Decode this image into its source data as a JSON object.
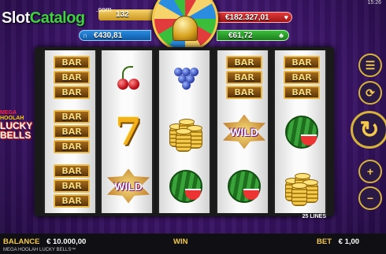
{
  "clock": "15:26",
  "watermark": {
    "part1": "Slot",
    "part2": "Catalog",
    "suffix": ".com"
  },
  "jackpots": {
    "top_left": "132",
    "bottom_left": "€430,81",
    "top_right": "€182.327,01",
    "bottom_right": "€61,72",
    "bottom_right_icon": "clover-icon",
    "top_right_icon": "heart-icon",
    "bottom_left_icon": "horseshoe-icon"
  },
  "logo": {
    "line1": "MEGA",
    "line2": "HOOLAH",
    "line3": "LUCKY",
    "line4": "BELLS"
  },
  "reels": [
    [
      "bar3",
      "bar3",
      "bar3"
    ],
    [
      "cherries",
      "seven",
      "wild"
    ],
    [
      "grapes",
      "coins",
      "watermelon"
    ],
    [
      "bar3",
      "wild",
      "watermelon"
    ],
    [
      "bar3",
      "watermelon",
      "coins"
    ]
  ],
  "symbols": {
    "bar": "BAR",
    "wild": "WILD",
    "seven": "7"
  },
  "lines_label": "25 LINES",
  "buttons": {
    "menu_icon": "☰",
    "autoplay_icon": "⟳",
    "spin_icon": "↻",
    "plus_icon": "+",
    "minus_icon": "−"
  },
  "footer": {
    "balance_label": "BALANCE",
    "balance_value": "€ 10.000,00",
    "win_label": "WIN",
    "bet_label": "BET",
    "bet_value": "€ 1,00",
    "game_title": "MEGA HOOLAH LUCKY BELLS™"
  }
}
